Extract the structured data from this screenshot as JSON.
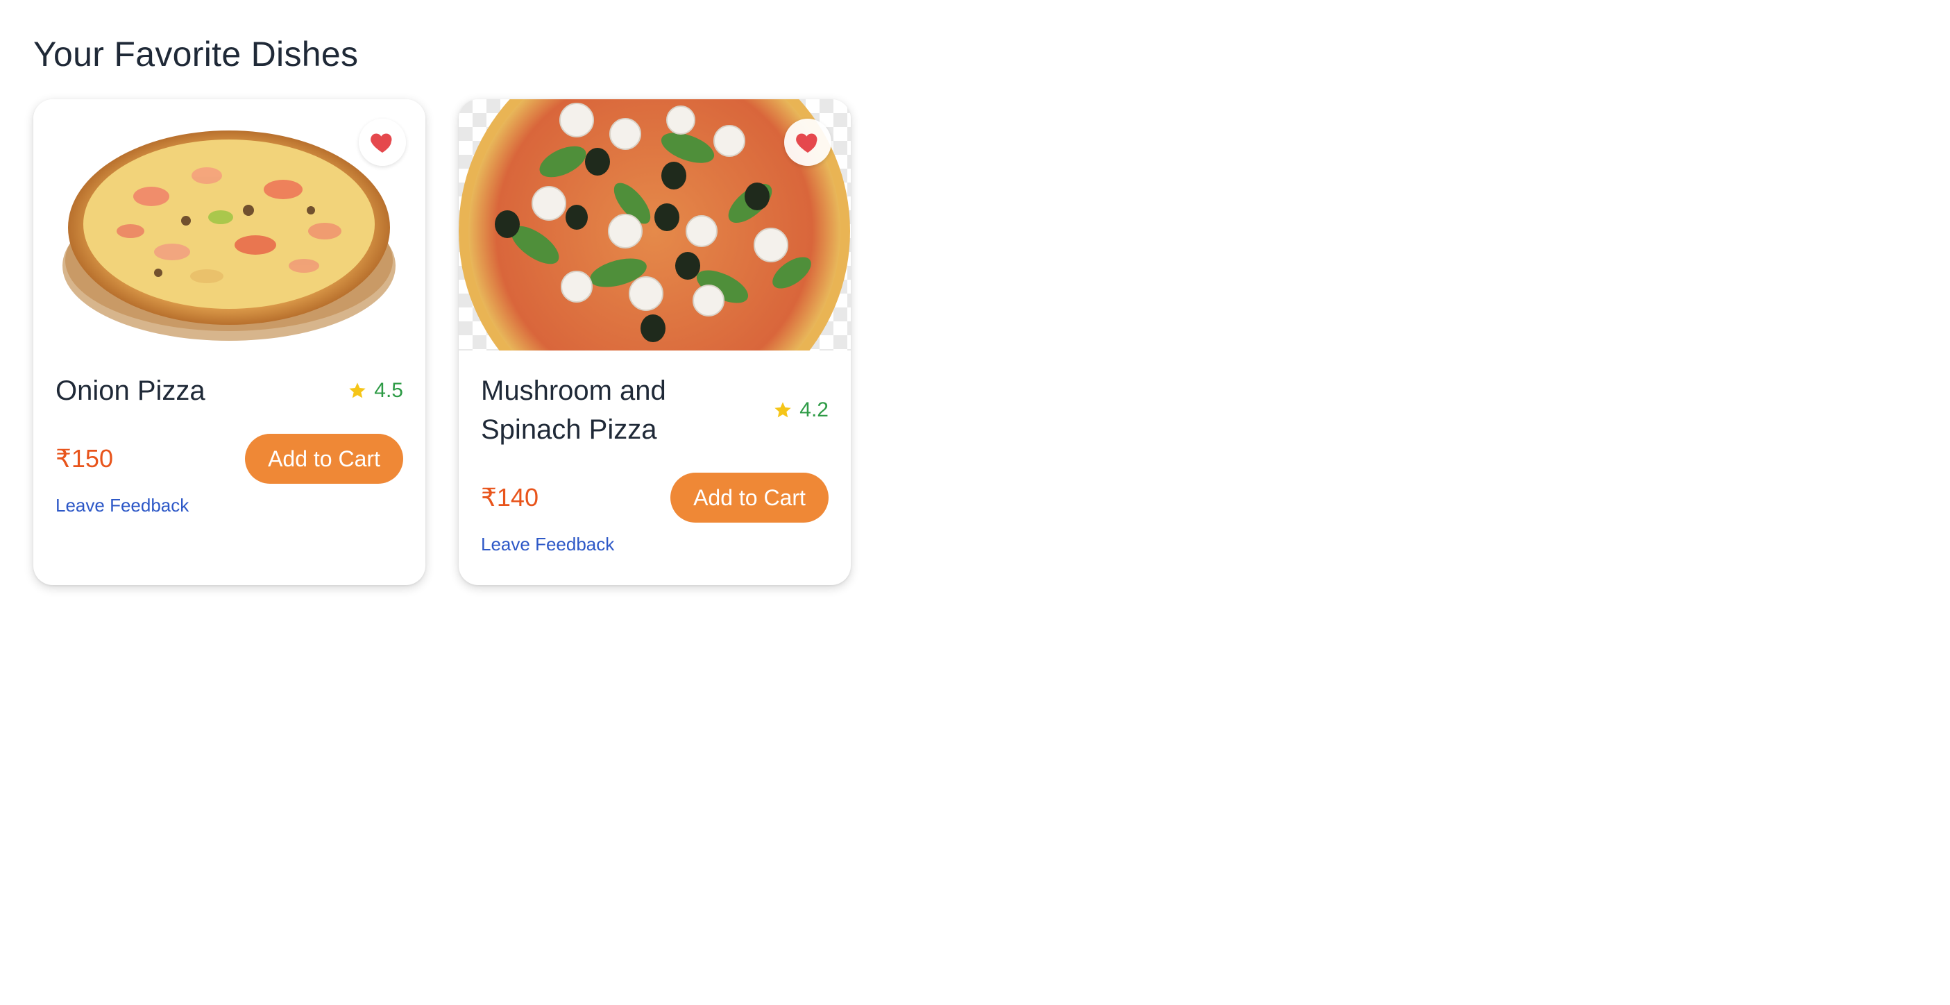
{
  "page": {
    "title": "Your Favorite Dishes"
  },
  "colors": {
    "price": "#e8541b",
    "add_button": "#ef8836",
    "rating": "#2e9b46",
    "star": "#f5c518",
    "heart": "#e5484d",
    "link": "#2d58c7"
  },
  "icons": {
    "favorite": "heart-icon",
    "rating": "star-icon"
  },
  "dishes": [
    {
      "name": "Onion Pizza",
      "rating": "4.5",
      "price": "₹150",
      "add_label": "Add to Cart",
      "feedback_label": "Leave Feedback",
      "favorited": true
    },
    {
      "name": "Mushroom and Spinach Pizza",
      "rating": "4.2",
      "price": "₹140",
      "add_label": "Add to Cart",
      "feedback_label": "Leave Feedback",
      "favorited": true
    }
  ]
}
